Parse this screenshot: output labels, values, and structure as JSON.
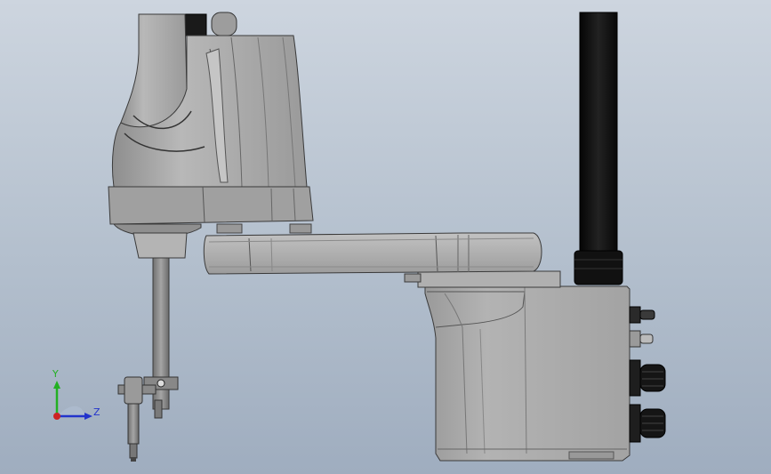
{
  "viewport": {
    "background_top": "#cdd5df",
    "background_bottom": "#9fadbf"
  },
  "model": {
    "body_color": "#a9a9a9",
    "edge_color": "#3a3a3a",
    "column_color": "#0f0f0f"
  },
  "triad": {
    "y_label": "Y",
    "z_label": "Z",
    "y_color": "#22b022",
    "z_color": "#2233cc",
    "x_color": "#cc2222"
  }
}
